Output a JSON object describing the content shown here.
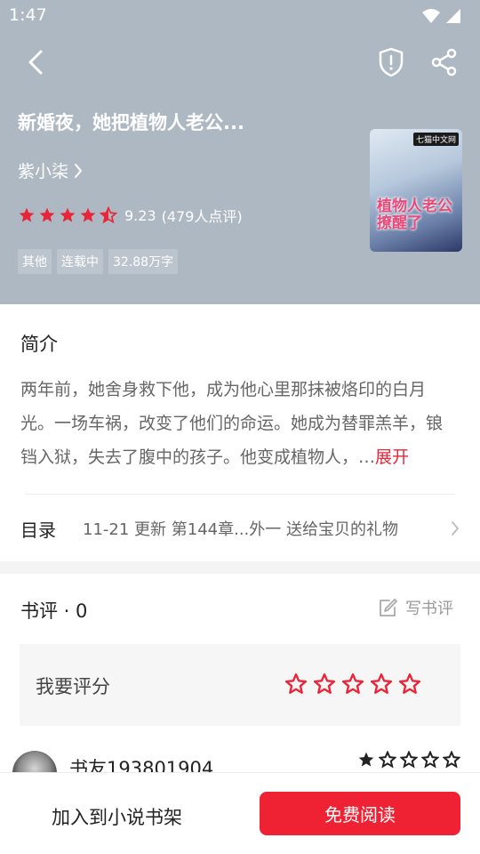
{
  "status_bar": {
    "time": "1:47"
  },
  "book": {
    "title": "新婚夜，她把植物人老公...",
    "author": "紫小柒",
    "rating": "9.23",
    "rating_count": "(479人点评)",
    "tags": [
      "其他",
      "连载中",
      "32.88万字"
    ],
    "cover": {
      "brand": "七猫中文网",
      "title": "植物人老公撩醒了"
    }
  },
  "intro": {
    "heading": "简介",
    "text": "两年前，她舍身救下他，成为他心里那抹被烙印的白月光。一场车祸，改变了他们的命运。她成为替罪羔羊，锒铛入狱，失去了腹中的孩子。他变成植物人，…",
    "expand_label": "展开"
  },
  "toc": {
    "label": "目录",
    "update_text": "11-21  更新  第144章...外一 送给宝贝的礼物"
  },
  "reviews": {
    "heading": "书评 · 0",
    "write_label": "写书评",
    "rate_prompt": "我要评分",
    "rate_star_count": 5,
    "first_comment": {
      "user": "书友193801904",
      "stars": 5
    }
  },
  "bottom_bar": {
    "add_shelf_label": "加入到小说书架",
    "read_label": "免费阅读"
  },
  "colors": {
    "header_bg": "#aeb8c2",
    "accent": "#ee2233",
    "star_red": "#e8263a"
  },
  "icons": [
    "back-icon",
    "shield-icon",
    "share-icon",
    "chevron-right-icon",
    "edit-icon",
    "star-icon"
  ]
}
